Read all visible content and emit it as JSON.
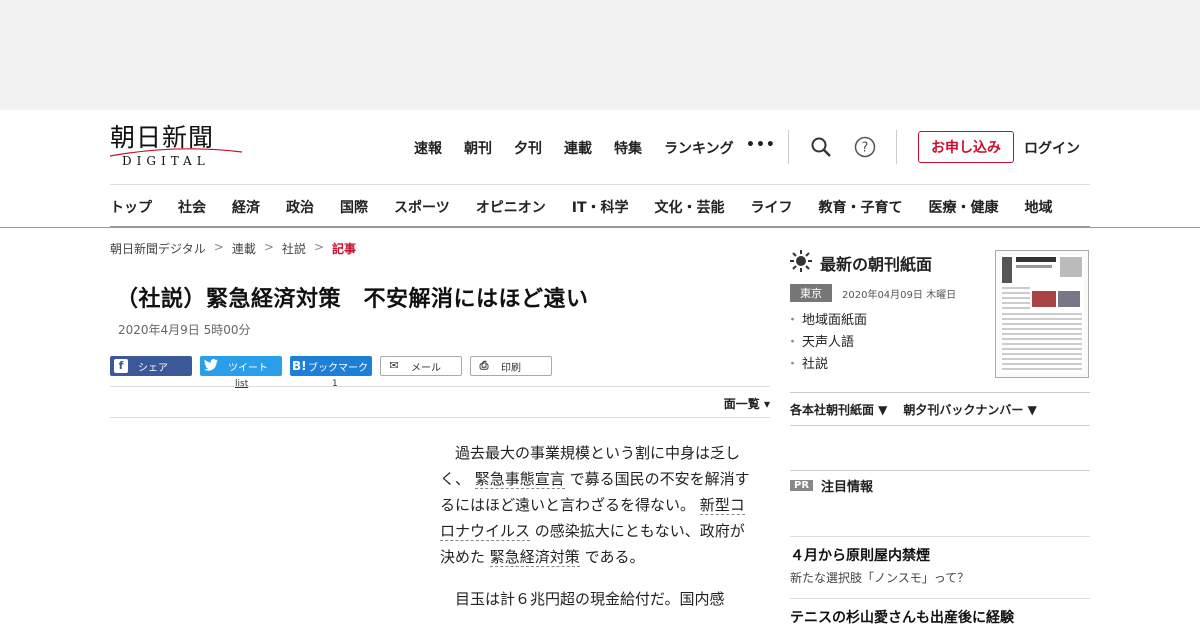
{
  "header": {
    "logo_main": "朝日新聞",
    "logo_sub": "DIGITAL",
    "nav": [
      "速報",
      "朝刊",
      "夕刊",
      "連載",
      "特集",
      "ランキング"
    ],
    "more": "•••",
    "subscribe_label": "お申し込み",
    "login_label": "ログイン"
  },
  "categories": [
    "トップ",
    "社会",
    "経済",
    "政治",
    "国際",
    "スポーツ",
    "オピニオン",
    "IT・科学",
    "文化・芸能",
    "ライフ",
    "教育・子育て",
    "医療・健康",
    "地域"
  ],
  "breadcrumb": {
    "items": [
      "朝日新聞デジタル",
      "連載",
      "社説"
    ],
    "current": "記事",
    "sep": ">"
  },
  "article": {
    "title": "（社説）緊急経済対策　不安解消にはほど遠い",
    "date": "2020年4月9日 5時00分",
    "share": {
      "facebook": "シェア",
      "twitter": "ツイート",
      "hatena": "ブックマーク",
      "mail": "メール",
      "print": "印刷",
      "twitter_count": "list",
      "hatena_count": "1"
    },
    "page_list_label": "面一覧",
    "p1_a": "過去最大の事業規模という割に中身は乏しく、",
    "p1_kw1": "緊急事態宣言",
    "p1_b": "で募る国民の不安を解消するにはほど遠いと言わざるを得ない。",
    "p1_kw2": "新型コロナウイルス",
    "p1_c": "の感染拡大にともない、政府が決めた",
    "p1_kw3": "緊急経済対策",
    "p1_d": "である。",
    "p2": "目玉は計６兆円超の現金給付だ。国内感"
  },
  "sidebar": {
    "paper_title": "最新の朝刊紙面",
    "region": "東京",
    "paper_date": "2020年04月09日 木曜日",
    "paper_links": [
      "地域面紙面",
      "天声人語",
      "社説"
    ],
    "backnumber": [
      "各本社朝刊紙面 ▼",
      "朝夕刊バックナンバー ▼"
    ],
    "pr_badge": "PR",
    "pr_heading": "注目情報",
    "pr_items": [
      {
        "title": "４月から原則屋内禁煙",
        "sub": "新たな選択肢「ノンスモ」って？"
      },
      {
        "title": "テニスの杉山愛さんも出産後に経験",
        "sub": ""
      }
    ]
  },
  "colors": {
    "accent": "#c8102e",
    "facebook": "#3b5998",
    "twitter": "#2a9ee9",
    "hatena": "#1d7fd8"
  }
}
